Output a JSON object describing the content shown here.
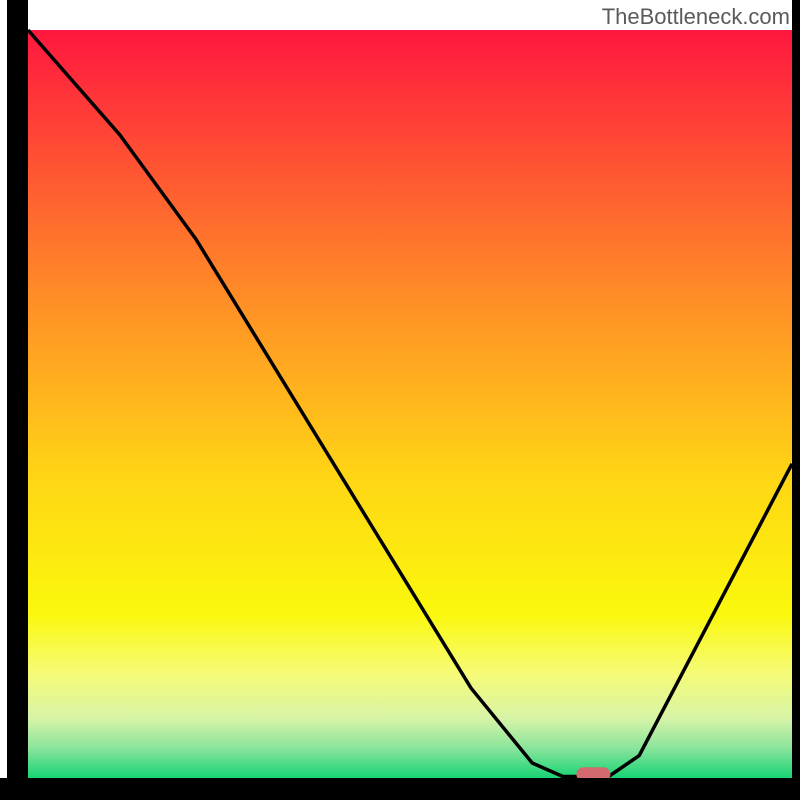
{
  "watermark": "TheBottleneck.com",
  "chart_data": {
    "type": "line",
    "title": "",
    "xlabel": "",
    "ylabel": "",
    "xlim": [
      0,
      100
    ],
    "ylim": [
      0,
      100
    ],
    "curve": [
      {
        "x": 0,
        "y": 100
      },
      {
        "x": 12,
        "y": 86
      },
      {
        "x": 22,
        "y": 72
      },
      {
        "x": 58,
        "y": 12
      },
      {
        "x": 66,
        "y": 2
      },
      {
        "x": 70,
        "y": 0.2
      },
      {
        "x": 76,
        "y": 0.2
      },
      {
        "x": 80,
        "y": 3
      },
      {
        "x": 100,
        "y": 42
      }
    ],
    "marker": {
      "x": 74,
      "y": 0.5,
      "color": "#d36a6f"
    },
    "gradient_stops": [
      {
        "offset": 0,
        "color": "#ff173f"
      },
      {
        "offset": 35,
        "color": "#ff8b27"
      },
      {
        "offset": 60,
        "color": "#ffd615"
      },
      {
        "offset": 78,
        "color": "#faf80c"
      },
      {
        "offset": 86,
        "color": "#f6fb77"
      },
      {
        "offset": 92,
        "color": "#d7f4a7"
      },
      {
        "offset": 96,
        "color": "#8ae49c"
      },
      {
        "offset": 100,
        "color": "#17d475"
      }
    ],
    "axes_color": "#000000"
  }
}
